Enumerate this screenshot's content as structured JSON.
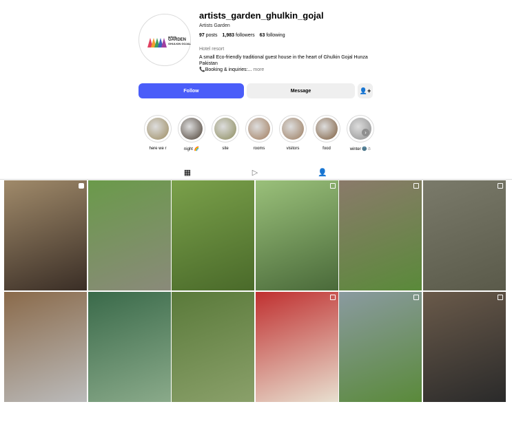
{
  "profile": {
    "username": "artists_garden_ghulkin_gojal",
    "more_icon": "ellipsis-icon",
    "full_name": "Artists Garden",
    "logo": {
      "line1": "artists",
      "line2": "GARDEN",
      "line3": "GHULKIN GOJAL"
    },
    "stats": {
      "posts": "97",
      "posts_label": "posts",
      "followers": "1,983",
      "followers_label": "followers",
      "following": "63",
      "following_label": "following"
    },
    "category": "Hotel resort",
    "bio_line1": "A small Eco-friendly traditional guest house in the heart of Ghulkin Gojal Hunza",
    "bio_line2": "Pakistan",
    "bio_line3": "📞Booking & inquiries:...",
    "bio_more": "more"
  },
  "actions": {
    "follow": "Follow",
    "message": "Message",
    "suggest_icon": "add-person-icon"
  },
  "highlights": [
    {
      "label": "here we r",
      "color": "#9b8a5e"
    },
    {
      "label": "night 🌈",
      "color": "#4a3e33"
    },
    {
      "label": "site",
      "color": "#8a8a5a"
    },
    {
      "label": "rooms",
      "color": "#a07a5a"
    },
    {
      "label": "visitors",
      "color": "#9a7a5c"
    },
    {
      "label": "food",
      "color": "#7b5a3a"
    },
    {
      "label": "winter 🌚☃",
      "color": "#8e8e8e"
    }
  ],
  "tabs": [
    {
      "name": "posts-tab-icon",
      "glyph": "▦"
    },
    {
      "name": "reels-tab-icon",
      "glyph": "▷"
    },
    {
      "name": "tagged-tab-icon",
      "glyph": "👤"
    }
  ],
  "posts": [
    {
      "alt": "man covering eyes in fur coat",
      "colors": [
        "#a08a6a",
        "#3a2e26"
      ],
      "badge": "video"
    },
    {
      "alt": "terraced garden with stone walls",
      "colors": [
        "#6a9a4a",
        "#8a8a7a"
      ],
      "badge": "none"
    },
    {
      "alt": "garden lawn with trees",
      "colors": [
        "#7aa04a",
        "#4a6a2a"
      ],
      "badge": "none"
    },
    {
      "alt": "man by window with trees",
      "colors": [
        "#9ac07a",
        "#4a6a3a"
      ],
      "badge": "multi"
    },
    {
      "alt": "window view to trees",
      "colors": [
        "#8a7a6a",
        "#5a8a3a"
      ],
      "badge": "multi"
    },
    {
      "alt": "lantern in stone window",
      "colors": [
        "#7a7a6a",
        "#5a5a4a"
      ],
      "badge": "multi"
    },
    {
      "alt": "outdoor seating with lanterns",
      "colors": [
        "#8a6a4a",
        "#bbbbbb"
      ],
      "badge": "none"
    },
    {
      "alt": "man in round mirror green room",
      "colors": [
        "#3a6a4a",
        "#8aaa8a"
      ],
      "badge": "none"
    },
    {
      "alt": "tree foliage",
      "colors": [
        "#5a7a3a",
        "#8aa06a"
      ],
      "badge": "none"
    },
    {
      "alt": "man looking at red painting",
      "colors": [
        "#c03030",
        "#e8e0d0"
      ],
      "badge": "multi"
    },
    {
      "alt": "mountain village fields",
      "colors": [
        "#8a9aa0",
        "#5a8a3a"
      ],
      "badge": "multi"
    },
    {
      "alt": "man at dinner",
      "colors": [
        "#6a5a4a",
        "#2a2a2a"
      ],
      "badge": "multi"
    }
  ]
}
